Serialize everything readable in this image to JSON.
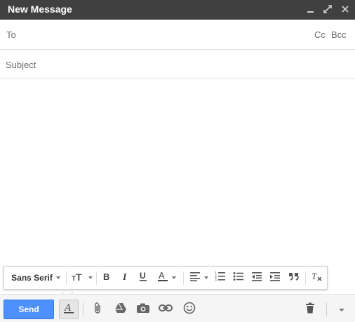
{
  "window": {
    "title": "New Message",
    "colors": {
      "titlebar": "#404040",
      "title_text": "#ffffff",
      "send": "#4d90fe",
      "icon": "#666666"
    }
  },
  "to": {
    "label": "To",
    "value": ""
  },
  "cc": {
    "cc_label": "Cc",
    "bcc_label": "Bcc"
  },
  "subject": {
    "placeholder": "Subject",
    "value": ""
  },
  "body": {
    "value": ""
  },
  "format_toolbar": {
    "font_family": "Sans Serif",
    "buttons": [
      "font-size",
      "bold",
      "italic",
      "underline",
      "text-color",
      "align",
      "numbered-list",
      "bulleted-list",
      "indent-less",
      "indent-more",
      "quote",
      "remove-formatting"
    ]
  },
  "bottom_bar": {
    "send_label": "Send",
    "buttons": [
      "formatting-options",
      "attach-files",
      "insert-from-drive",
      "insert-photo",
      "insert-link",
      "insert-emoji",
      "discard-draft",
      "more-options"
    ]
  }
}
